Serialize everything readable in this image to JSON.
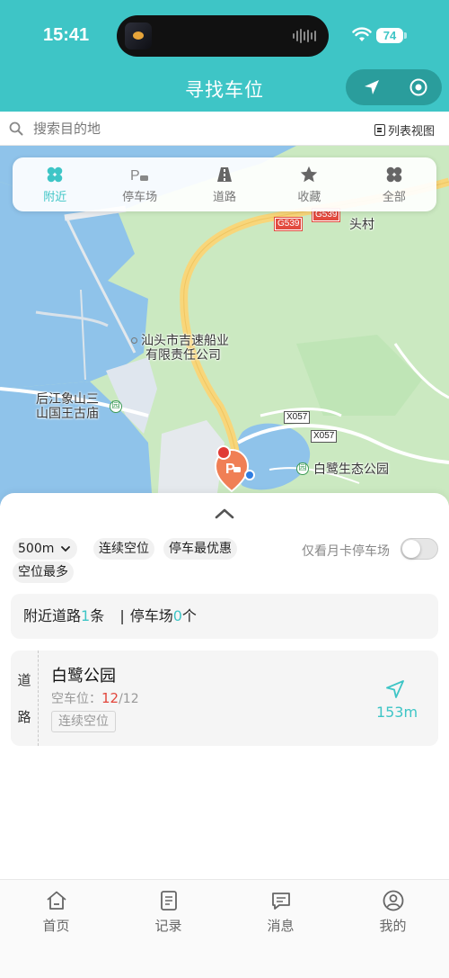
{
  "status_bar": {
    "time": "15:41",
    "battery": "74"
  },
  "header": {
    "title": "寻找车位"
  },
  "capsule": {
    "locate_icon": "navigate-arrow-icon",
    "target_icon": "target-icon"
  },
  "search": {
    "placeholder": "搜索目的地",
    "list_view_label": "列表视图"
  },
  "categories": [
    {
      "label": "附近",
      "icon": "clover-icon",
      "active": true
    },
    {
      "label": "停车场",
      "icon": "parking-car-icon",
      "active": false
    },
    {
      "label": "道路",
      "icon": "road-icon",
      "active": false
    },
    {
      "label": "收藏",
      "icon": "star-icon",
      "active": false
    },
    {
      "label": "全部",
      "icon": "grid-clover-icon",
      "active": false
    }
  ],
  "map": {
    "labels": {
      "company_line1": "汕头市吉速船业",
      "company_line2": "有限责任公司",
      "temple_line1": "后江象山三",
      "temple_line2": "山国王古庙",
      "park": "白鹭生态公园",
      "village": "头村"
    },
    "roads": {
      "g539_a": "G539",
      "g539_b": "G539",
      "x057_a": "X057",
      "x057_b": "X057"
    },
    "poi_symbol": "园"
  },
  "sheet": {
    "radius_select": "500m",
    "filter_continuous": "连续空位",
    "filter_best_price": "停车最优惠",
    "filter_most_spaces": "空位最多",
    "monthly_toggle_label": "仅看月卡停车场",
    "monthly_toggle_on": false,
    "summary": {
      "roads_prefix": "附近道路",
      "roads_count": "1",
      "roads_unit": "条",
      "divider": "|",
      "lots_prefix": "停车场",
      "lots_count": "0",
      "lots_unit": "个"
    },
    "results": [
      {
        "type_char_1": "道",
        "type_char_2": "路",
        "name": "白鹭公园",
        "spaces_label": "空车位：",
        "free": "12",
        "total": "/12",
        "tag": "连续空位",
        "distance": "153m"
      }
    ]
  },
  "tabbar": [
    {
      "label": "首页",
      "icon": "home-icon"
    },
    {
      "label": "记录",
      "icon": "document-icon"
    },
    {
      "label": "消息",
      "icon": "message-icon"
    },
    {
      "label": "我的",
      "icon": "user-icon"
    }
  ],
  "colors": {
    "brand": "#3ec5c6",
    "alert_red": "#e2463c",
    "map_water": "#8fc3ea",
    "map_land": "#cbe9c1"
  }
}
